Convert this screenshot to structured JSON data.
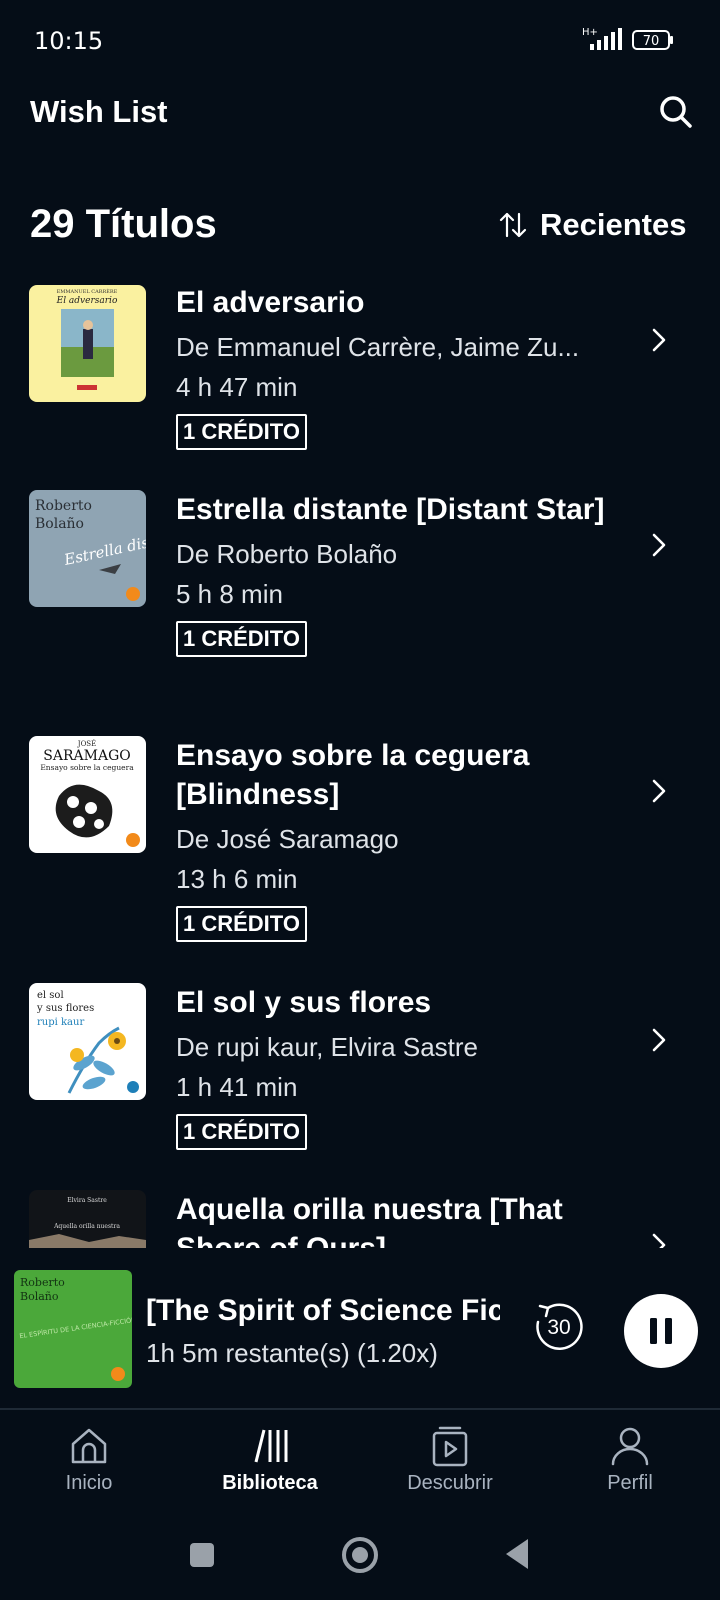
{
  "status_bar": {
    "time": "10:15",
    "network": "H+",
    "battery": "70"
  },
  "header": {
    "title": "Wish List",
    "search_icon": "search-icon"
  },
  "list_header": {
    "count": "29 Títulos",
    "sort_label": "Recientes",
    "sort_icon": "sort-arrows-icon"
  },
  "items": [
    {
      "title": "El adversario",
      "author": "De Emmanuel Carrère, Jaime Zu...",
      "duration": "4 h 47 min",
      "badge": "1 CRÉDITO"
    },
    {
      "title": "Estrella distante [Distant Star]",
      "author": "De Roberto Bolaño",
      "duration": "5 h 8 min",
      "badge": "1 CRÉDITO"
    },
    {
      "title": "Ensayo sobre la ceguera [Blindness]",
      "author": "De José Saramago",
      "duration": "13 h 6 min",
      "badge": "1 CRÉDITO"
    },
    {
      "title": "El sol y sus flores",
      "author": "De rupi kaur, Elvira Sastre",
      "duration": "1 h 41 min",
      "badge": "1 CRÉDITO"
    },
    {
      "title": "Aquella orilla nuestra [That Shore of Ours]",
      "author": "",
      "duration": "",
      "badge": ""
    }
  ],
  "covers": {
    "adversario": {
      "author": "EMMANUEL CARRÈRE",
      "title": "El adversario"
    },
    "estrella": {
      "author_line1": "Roberto",
      "author_line2": "Bolaño",
      "script": "Estrella distante"
    },
    "ceguera": {
      "first": "JOSÉ",
      "author": "SARAMAGO",
      "title": "Ensayo sobre la ceguera"
    },
    "sol": {
      "line1": "el sol",
      "line2": "y sus flores",
      "author": "rupi kaur"
    },
    "orilla": {
      "author": "Elvira Sastre",
      "title": "Aquella orilla nuestra"
    },
    "spirit": {
      "author_line1": "Roberto",
      "author_line2": "Bolaño",
      "title": "EL ESPÍRITU DE LA CIENCIA-FICCIÓN"
    }
  },
  "mini_player": {
    "title": "[The Spirit of Science Fict",
    "subtitle": "1h 5m restante(s) (1.20x)",
    "skip_seconds": "30"
  },
  "bottom_nav": [
    {
      "label": "Inicio",
      "icon": "home-icon"
    },
    {
      "label": "Biblioteca",
      "icon": "library-icon",
      "active": true
    },
    {
      "label": "Descubrir",
      "icon": "discover-icon"
    },
    {
      "label": "Perfil",
      "icon": "profile-icon"
    }
  ],
  "colors": {
    "background": "#050d17",
    "text": "#ffffff",
    "secondary_text": "#dfe3e8",
    "nav_inactive": "#a9b3c0"
  }
}
